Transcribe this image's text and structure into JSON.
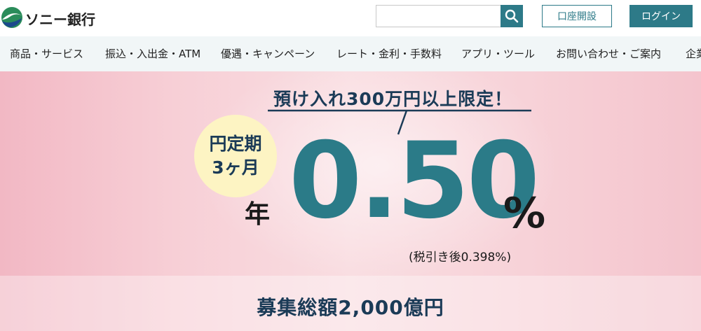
{
  "header": {
    "logo_text": "ソニー銀行",
    "search": {
      "value": "",
      "placeholder": ""
    },
    "open_account_label": "口座開設",
    "login_label": "ログイン"
  },
  "nav": {
    "items": [
      {
        "label": "商品・サービス"
      },
      {
        "label": "振込・入出金・ATM"
      },
      {
        "label": "優遇・キャンペーン"
      },
      {
        "label": "レート・金利・手数料"
      },
      {
        "label": "アプリ・ツール"
      },
      {
        "label": "お問い合わせ・ご案内"
      },
      {
        "label": "企業"
      }
    ]
  },
  "hero": {
    "headline": "預け入れ300万円以上限定！",
    "badge_line1": "円定期",
    "badge_line2": "3ヶ月",
    "prefix": "年",
    "rate": "0.50",
    "unit": "%",
    "after_tax": "(税引き後0.398%)",
    "total_raised": "募集総額2,000億円"
  },
  "colors": {
    "brand_teal": "#2d7a88",
    "navy_text": "#1b3b57",
    "badge_yellow": "#fdf4c3",
    "nav_bg": "#f1f6f7"
  }
}
